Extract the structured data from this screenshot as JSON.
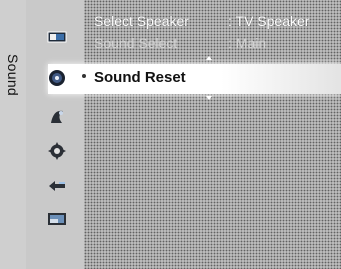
{
  "side_tab": {
    "label": "Sound"
  },
  "menu": {
    "rows": [
      {
        "label": "Select Speaker",
        "value": ": TV Speaker"
      },
      {
        "label": "Sound Select",
        "value": ": Main"
      }
    ],
    "selected": {
      "label": "Sound Reset"
    }
  },
  "icons": [
    "picture-icon",
    "sound-icon",
    "channel-icon",
    "setup-icon",
    "input-icon",
    "application-icon"
  ],
  "colors": {
    "highlight": "#ffffff",
    "menu_text": "#ffffff",
    "dim_text": "#d2d2d2",
    "selected_text": "#111111"
  }
}
